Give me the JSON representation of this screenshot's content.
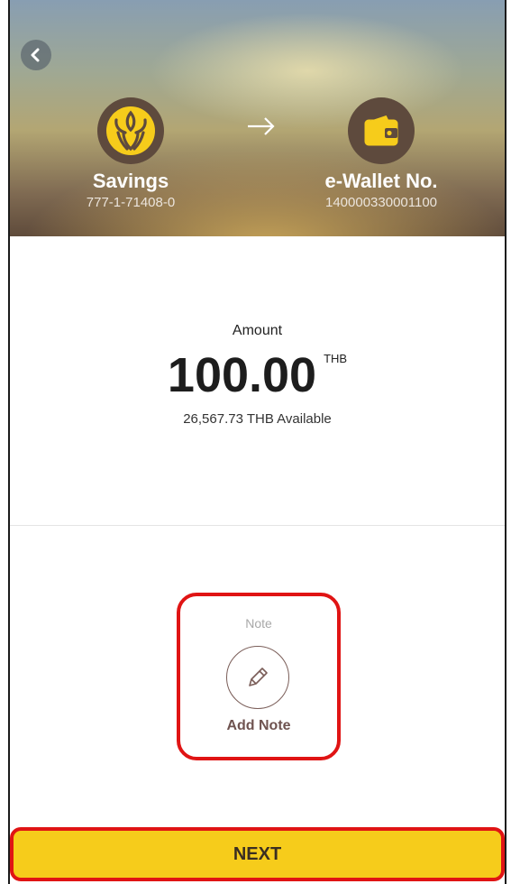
{
  "header": {
    "from_account": {
      "name": "Savings",
      "number": "777-1-71408-0",
      "icon": "bank-logo-icon"
    },
    "to_account": {
      "name": "e-Wallet No.",
      "number": "140000330001100",
      "icon": "wallet-icon"
    },
    "back_icon": "chevron-left-icon",
    "arrow_icon": "arrow-right-icon"
  },
  "amount": {
    "label": "Amount",
    "value": "100.00",
    "currency": "THB",
    "available": "26,567.73 THB Available"
  },
  "note": {
    "label": "Note",
    "action_label": "Add Note",
    "icon": "pencil-icon"
  },
  "footer": {
    "next_label": "NEXT"
  },
  "colors": {
    "brand_yellow": "#f6cc1b",
    "brand_brown": "#5e4a3d",
    "highlight_red": "#e01414",
    "note_text": "#6f5350"
  }
}
